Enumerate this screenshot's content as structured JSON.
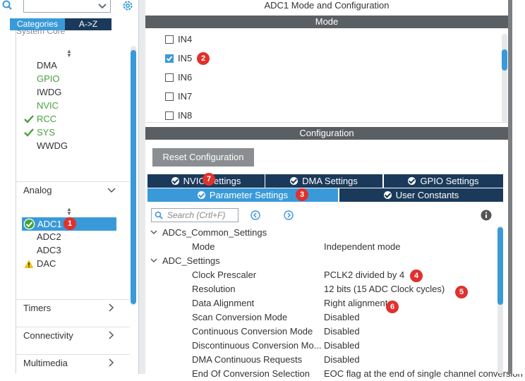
{
  "left": {
    "search_placeholder": "",
    "tabs": {
      "categories": "Categories",
      "az": "A->Z"
    },
    "cut_label": "System Core",
    "system_core_items": [
      {
        "label": "DMA",
        "color": "#333333",
        "check": false
      },
      {
        "label": "GPIO",
        "color": "#46a23d",
        "check": false
      },
      {
        "label": "IWDG",
        "color": "#333333",
        "check": false
      },
      {
        "label": "NVIC",
        "color": "#46a23d",
        "check": false
      },
      {
        "label": "RCC",
        "color": "#46a23d",
        "check": true
      },
      {
        "label": "SYS",
        "color": "#46a23d",
        "check": true
      },
      {
        "label": "WWDG",
        "color": "#333333",
        "check": false
      }
    ],
    "analog_label": "Analog",
    "analog_items": [
      {
        "label": "ADC1",
        "selected": true,
        "status": "ok"
      },
      {
        "label": "ADC2",
        "selected": false,
        "status": ""
      },
      {
        "label": "ADC3",
        "selected": false,
        "status": ""
      },
      {
        "label": "DAC",
        "selected": false,
        "status": "warning"
      }
    ],
    "sections": [
      "Timers",
      "Connectivity",
      "Multimedia"
    ]
  },
  "main": {
    "title": "ADC1 Mode and Configuration",
    "mode_header": "Mode",
    "mode_items": [
      {
        "label": "IN4",
        "checked": false
      },
      {
        "label": "IN5",
        "checked": true
      },
      {
        "label": "IN6",
        "checked": false
      },
      {
        "label": "IN7",
        "checked": false
      },
      {
        "label": "IN8",
        "checked": false
      }
    ],
    "config_header": "Configuration",
    "reset_button": "Reset Configuration",
    "settings_tabs_row1": [
      "NVIC Settings",
      "DMA Settings",
      "GPIO Settings"
    ],
    "settings_tabs_row2": [
      "Parameter Settings",
      "User Constants"
    ],
    "search_placeholder": "Search (Crtl+F)",
    "parameters": [
      {
        "kind": "group",
        "label": "ADCs_Common_Settings"
      },
      {
        "kind": "param",
        "name": "Mode",
        "value": "Independent mode"
      },
      {
        "kind": "group",
        "label": "ADC_Settings"
      },
      {
        "kind": "param",
        "name": "Clock Prescaler",
        "value": "PCLK2 divided by 4"
      },
      {
        "kind": "param",
        "name": "Resolution",
        "value": "12 bits (15 ADC Clock cycles)"
      },
      {
        "kind": "param",
        "name": "Data Alignment",
        "value": "Right alignment"
      },
      {
        "kind": "param",
        "name": "Scan Conversion Mode",
        "value": "Disabled"
      },
      {
        "kind": "param",
        "name": "Continuous Conversion Mode",
        "value": "Disabled"
      },
      {
        "kind": "param",
        "name": "Discontinuous Conversion Mo...",
        "value": "Disabled"
      },
      {
        "kind": "param",
        "name": "DMA Continuous Requests",
        "value": "Disabled"
      },
      {
        "kind": "param",
        "name": "End Of Conversion Selection",
        "value": "EOC flag at the end of single channel conversion"
      }
    ]
  },
  "badges": [
    "1",
    "2",
    "3",
    "4",
    "5",
    "6",
    "7"
  ],
  "colors": {
    "accent": "#3a9ad9",
    "navy": "#1b3a5b",
    "header_gray": "#5a5f63",
    "green": "#46a23d",
    "badge_red": "#e0312d",
    "warning": "#f4c20d"
  },
  "icons": [
    "search-icon",
    "chevron-down-icon",
    "gear-icon",
    "check-icon",
    "warning-icon",
    "info-icon",
    "arrow-left-icon",
    "arrow-right-icon"
  ]
}
